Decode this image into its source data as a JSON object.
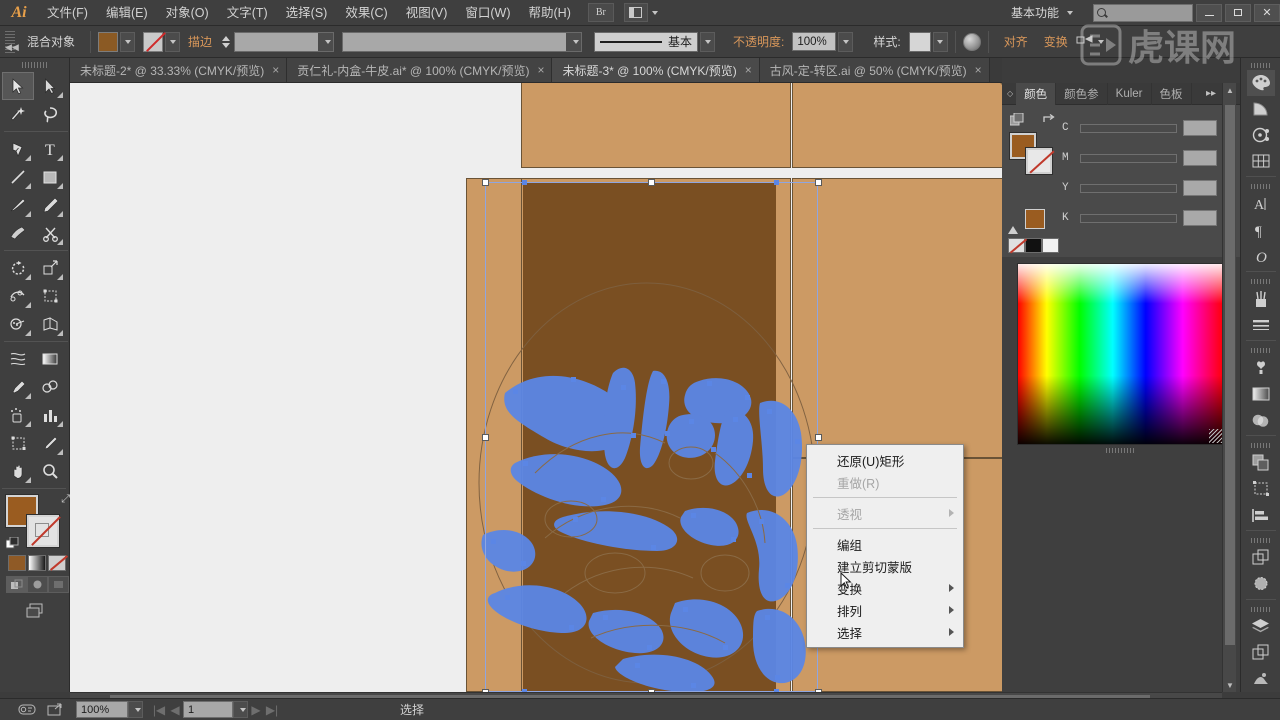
{
  "app": {
    "name": "Adobe Illustrator",
    "logo": "Ai"
  },
  "menubar": {
    "items": [
      {
        "label": "文件(F)"
      },
      {
        "label": "编辑(E)"
      },
      {
        "label": "对象(O)"
      },
      {
        "label": "文字(T)"
      },
      {
        "label": "选择(S)"
      },
      {
        "label": "效果(C)"
      },
      {
        "label": "视图(V)"
      },
      {
        "label": "窗口(W)"
      },
      {
        "label": "帮助(H)"
      }
    ],
    "bridge_label": "Br",
    "arrange_docs": "arrange-documents-icon",
    "workspace": "基本功能",
    "search_placeholder": "",
    "window_buttons": [
      "minimize",
      "maximize",
      "close"
    ]
  },
  "controlbar": {
    "object_label": "混合对象",
    "fill_color": "#8b5a24",
    "stroke_color": "none",
    "stroke_label": "描边",
    "stroke_weight": "",
    "stroke_profile": "",
    "brush_label": "基本",
    "opacity_label": "不透明度:",
    "opacity_value": "100%",
    "style_label": "样式:",
    "align_label": "对齐",
    "transform_label": "变换",
    "distribute_icon": "distribute-icon"
  },
  "tabs": [
    {
      "label": "未标题-2* @ 33.33% (CMYK/预览)",
      "active": false,
      "close": "×"
    },
    {
      "label": "贡仁礼-内盒-牛皮.ai* @ 100% (CMYK/预览)",
      "active": false,
      "close": "×"
    },
    {
      "label": "未标题-3* @ 100% (CMYK/预览)",
      "active": true,
      "close": "×"
    },
    {
      "label": "古风-定-转区.ai @ 50% (CMYK/预览)",
      "active": false,
      "close": "×"
    }
  ],
  "tools": {
    "rows": [
      [
        {
          "name": "selection-tool",
          "selected": true
        },
        {
          "name": "direct-selection-tool",
          "selected": false
        }
      ],
      [
        {
          "name": "magic-wand-tool",
          "selected": false
        },
        {
          "name": "lasso-tool",
          "selected": false
        }
      ],
      [
        {
          "name": "pen-tool",
          "selected": false
        },
        {
          "name": "type-tool",
          "selected": false
        }
      ],
      [
        {
          "name": "line-segment-tool",
          "selected": false
        },
        {
          "name": "rectangle-tool",
          "selected": false
        }
      ],
      [
        {
          "name": "paintbrush-tool",
          "selected": false
        },
        {
          "name": "pencil-tool",
          "selected": false
        }
      ],
      [
        {
          "name": "blob-brush-tool",
          "selected": false
        },
        {
          "name": "eraser-scissors-tool",
          "selected": false
        }
      ],
      [
        {
          "name": "rotate-tool",
          "selected": false
        },
        {
          "name": "scale-tool",
          "selected": false
        }
      ],
      [
        {
          "name": "width-tool",
          "selected": false
        },
        {
          "name": "free-transform-tool",
          "selected": false
        }
      ],
      [
        {
          "name": "shape-builder-tool",
          "selected": false
        },
        {
          "name": "perspective-grid-tool",
          "selected": false
        }
      ],
      [
        {
          "name": "mesh-tool",
          "selected": false
        },
        {
          "name": "gradient-tool",
          "selected": false
        }
      ],
      [
        {
          "name": "eyedropper-tool",
          "selected": false
        },
        {
          "name": "blend-tool",
          "selected": false
        }
      ],
      [
        {
          "name": "symbol-sprayer-tool",
          "selected": false
        },
        {
          "name": "column-graph-tool",
          "selected": false
        }
      ],
      [
        {
          "name": "artboard-tool",
          "selected": false
        },
        {
          "name": "slice-tool",
          "selected": false
        }
      ],
      [
        {
          "name": "hand-tool",
          "selected": false
        },
        {
          "name": "zoom-tool",
          "selected": false
        }
      ]
    ],
    "fill_color": "#9a5c20",
    "stroke_color": "none",
    "color_modes": [
      "color-swatch",
      "gradient-swatch",
      "none-swatch"
    ],
    "draw_modes": [
      "draw-normal",
      "draw-behind",
      "draw-inside"
    ],
    "screen_mode": "change-screen-mode"
  },
  "canvas": {
    "paper_background": "#eeeeee",
    "panel_fill": "#cc9a64",
    "selected_rect_fill": "#7a4f22",
    "anchor_color": "#5b86e5",
    "selection_border": "#8fa6e0",
    "artwork_label": "vector-artwork-selected"
  },
  "context_menu": {
    "items": [
      {
        "label": "还原(U)矩形",
        "disabled": false,
        "submenu": false
      },
      {
        "label": "重做(R)",
        "disabled": true,
        "submenu": false
      },
      {
        "separator": true
      },
      {
        "label": "透视",
        "disabled": true,
        "submenu": true
      },
      {
        "separator": true
      },
      {
        "label": "编组",
        "disabled": false,
        "submenu": false
      },
      {
        "label": "建立剪切蒙版",
        "disabled": false,
        "submenu": false
      },
      {
        "label": "变换",
        "disabled": false,
        "submenu": true
      },
      {
        "label": "排列",
        "disabled": false,
        "submenu": true
      },
      {
        "label": "选择",
        "disabled": false,
        "submenu": true
      }
    ]
  },
  "color_panel": {
    "tabs": [
      {
        "label": "颜色",
        "active": true
      },
      {
        "label": "颜色参",
        "active": false
      },
      {
        "label": "Kuler",
        "active": false
      },
      {
        "label": "色板",
        "active": false
      }
    ],
    "sliders": [
      {
        "label": "C",
        "value": "",
        "unit": "%"
      },
      {
        "label": "M",
        "value": "",
        "unit": "%"
      },
      {
        "label": "Y",
        "value": "",
        "unit": "%"
      },
      {
        "label": "K",
        "value": "",
        "unit": "%"
      }
    ],
    "fill_color": "#9a5c20",
    "stroke_color": "none",
    "quick_swatches": [
      "none",
      "#111111",
      "#f2f2f2"
    ]
  },
  "icon_dock": {
    "groups": [
      [
        {
          "name": "color-panel-icon",
          "active": true
        },
        {
          "name": "color-guide-icon",
          "active": false
        },
        {
          "name": "kuler-icon",
          "active": false
        },
        {
          "name": "swatches-icon",
          "active": false
        }
      ],
      [
        {
          "name": "character-icon",
          "active": false
        },
        {
          "name": "paragraph-icon",
          "active": false
        },
        {
          "name": "opentype-icon",
          "active": false
        }
      ],
      [
        {
          "name": "brushes-icon",
          "active": false
        },
        {
          "name": "stroke-icon",
          "active": false
        }
      ],
      [
        {
          "name": "symbols-icon",
          "active": false
        },
        {
          "name": "gradient-icon",
          "active": false
        },
        {
          "name": "transparency-icon",
          "active": false
        }
      ],
      [
        {
          "name": "pathfinder-icon",
          "active": false
        },
        {
          "name": "transform-icon",
          "active": false
        },
        {
          "name": "align-icon",
          "active": false
        }
      ],
      [
        {
          "name": "appearance-icon",
          "active": false
        },
        {
          "name": "graphic-styles-icon",
          "active": false
        }
      ],
      [
        {
          "name": "layers-icon",
          "active": false
        },
        {
          "name": "artboards-icon",
          "active": false
        },
        {
          "name": "links-icon",
          "active": false
        }
      ]
    ]
  },
  "statusbar": {
    "fit_icon": "fit-artboard-icon",
    "share_icon": "share-icon",
    "zoom_value": "100%",
    "page_value": "1",
    "status_text": "选择"
  },
  "watermark": {
    "text": "虎课网"
  }
}
